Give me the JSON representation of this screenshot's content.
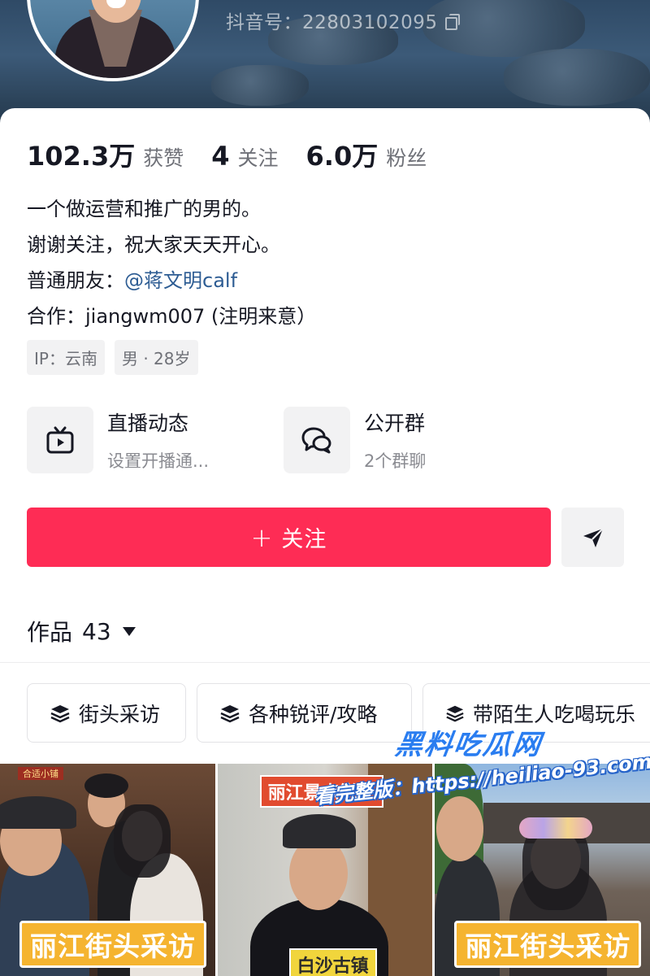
{
  "header": {
    "douyin_id_label": "抖音号：22803102095"
  },
  "stats": [
    {
      "value": "102.3万",
      "label": "获赞"
    },
    {
      "value": "4",
      "label": "关注"
    },
    {
      "value": "6.0万",
      "label": "粉丝"
    }
  ],
  "bio": {
    "line1": "一个做运营和推广的男的。",
    "line2": "谢谢关注，祝大家天天开心。",
    "line3_prefix": "普通朋友：",
    "line3_mention": "@蒋文明calf",
    "line4": "合作：jiangwm007 (注明来意）"
  },
  "tags": [
    "IP：云南",
    "男 · 28岁"
  ],
  "features": [
    {
      "title": "直播动态",
      "subtitle": "设置开播通...",
      "icon": "tv-icon"
    },
    {
      "title": "公开群",
      "subtitle": "2个群聊",
      "icon": "chat-bubbles-icon"
    }
  ],
  "actions": {
    "follow_label": "关注",
    "follow_plus": "+",
    "share_icon": "send-icon",
    "accent_color": "#fe2c55"
  },
  "works": {
    "label": "作品",
    "count": "43"
  },
  "collections": [
    "街头采访",
    "各种锐评/攻略",
    "带陌生人吃喝玩乐"
  ],
  "videos": [
    {
      "label": "丽江街头采访",
      "sign": "合适小铺"
    },
    {
      "top_label": "丽江景点锐评",
      "bottom_label": "白沙古镇"
    },
    {
      "label": "丽江街头采访"
    }
  ],
  "watermark": {
    "title": "黑料吃瓜网",
    "url": "看完整版：https://heiliao-93.com"
  }
}
